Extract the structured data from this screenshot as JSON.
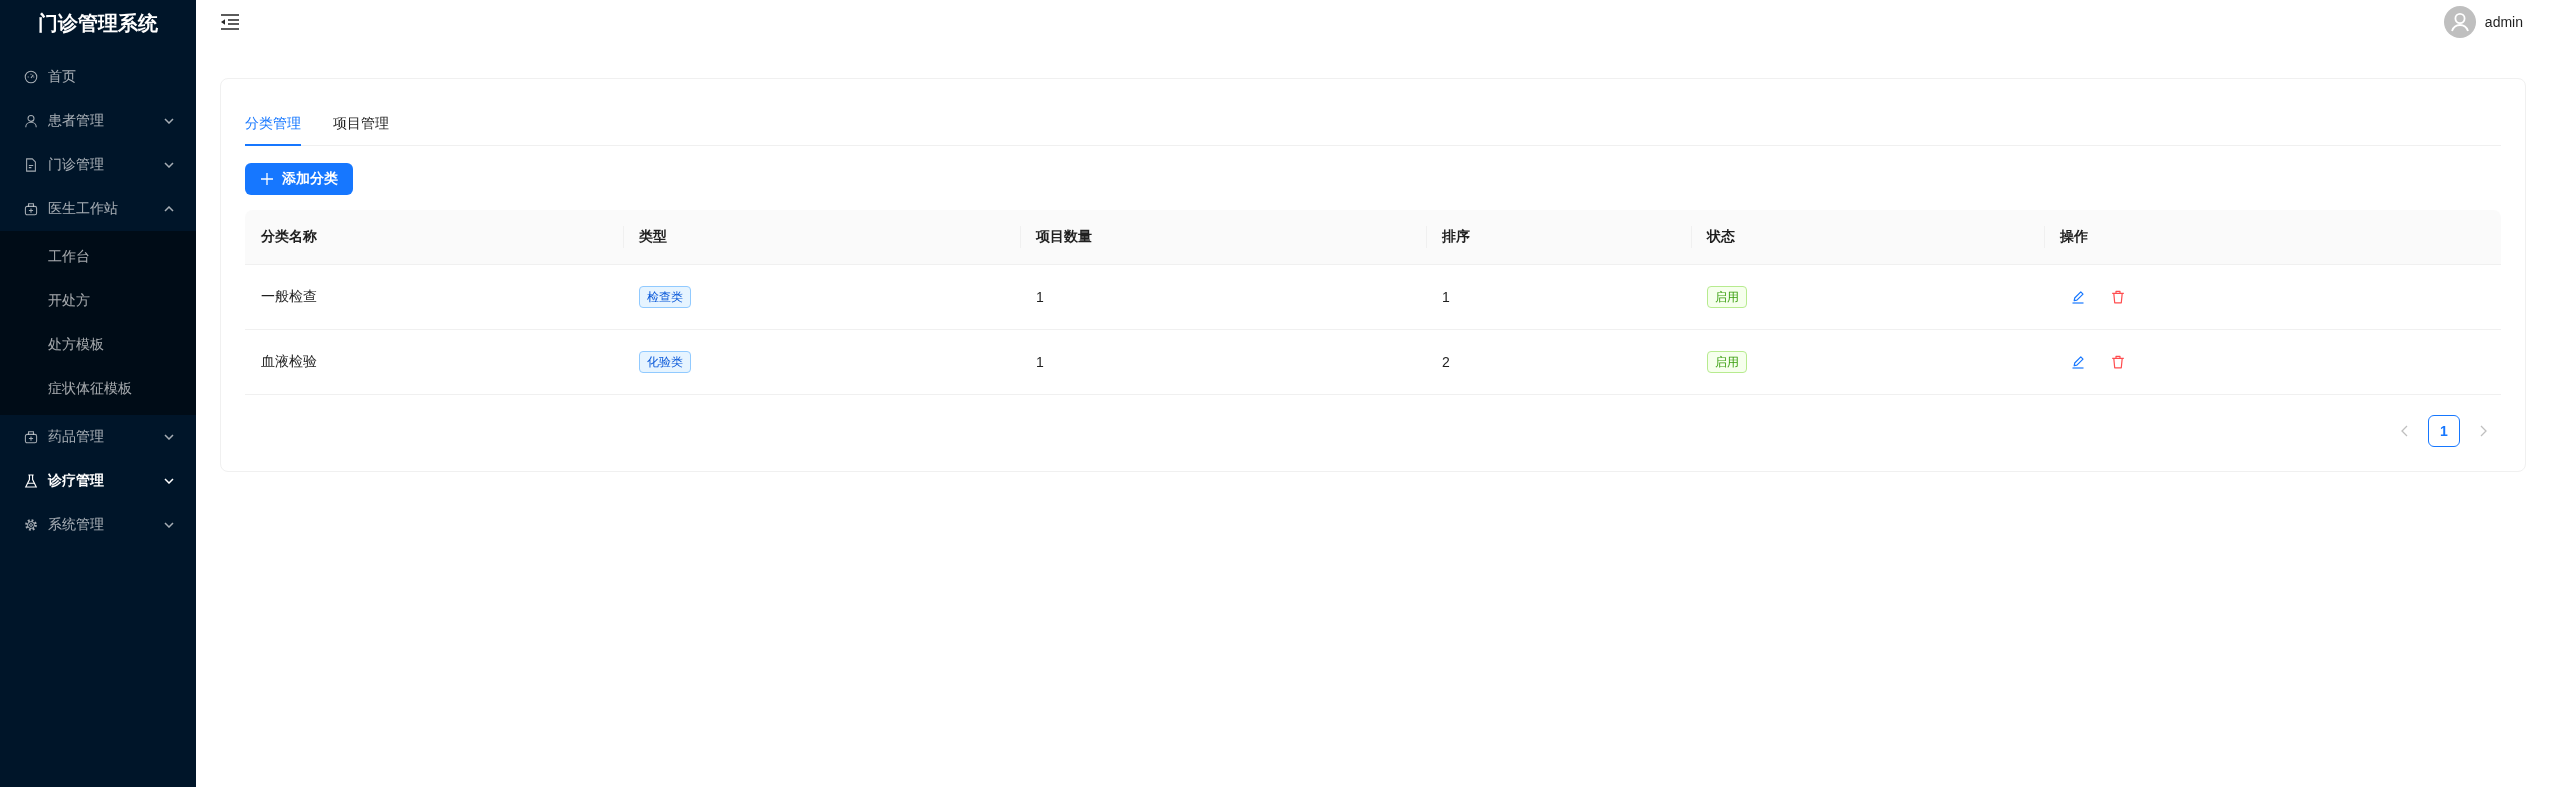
{
  "sidebar": {
    "title": "门诊管理系统",
    "items": [
      {
        "label": "首页",
        "kind": "link",
        "selected": false
      },
      {
        "label": "患者管理",
        "kind": "submenu",
        "expanded": false,
        "selected": false
      },
      {
        "label": "门诊管理",
        "kind": "submenu",
        "expanded": false,
        "selected": false
      },
      {
        "label": "医生工作站",
        "kind": "submenu",
        "expanded": true,
        "selected": false,
        "children": [
          {
            "label": "工作台",
            "selected": false
          },
          {
            "label": "开处方",
            "selected": false
          },
          {
            "label": "处方模板",
            "selected": false
          },
          {
            "label": "症状体征模板",
            "selected": false
          }
        ]
      },
      {
        "label": "药品管理",
        "kind": "submenu",
        "expanded": false,
        "selected": false
      },
      {
        "label": "诊疗管理",
        "kind": "submenu",
        "expanded": false,
        "selected": true
      },
      {
        "label": "系统管理",
        "kind": "submenu",
        "expanded": false,
        "selected": false
      }
    ]
  },
  "header": {
    "user": "admin"
  },
  "tabs": [
    {
      "label": "分类管理",
      "selected": true
    },
    {
      "label": "项目管理",
      "selected": false
    }
  ],
  "toolbar": {
    "add_button": "添加分类"
  },
  "table": {
    "columns": [
      "分类名称",
      "类型",
      "项目数量",
      "排序",
      "状态",
      "操作"
    ],
    "rows": [
      {
        "name": "一般检查",
        "type": "检查类",
        "item_count": "1",
        "sort_order": "1",
        "status": "启用",
        "enabled": true
      },
      {
        "name": "血液检验",
        "type": "化验类",
        "item_count": "1",
        "sort_order": "2",
        "status": "启用",
        "enabled": true
      }
    ]
  },
  "pagination": {
    "prev_disabled": true,
    "next_disabled": true,
    "pages": [
      {
        "label": "1",
        "selected": true
      }
    ]
  }
}
